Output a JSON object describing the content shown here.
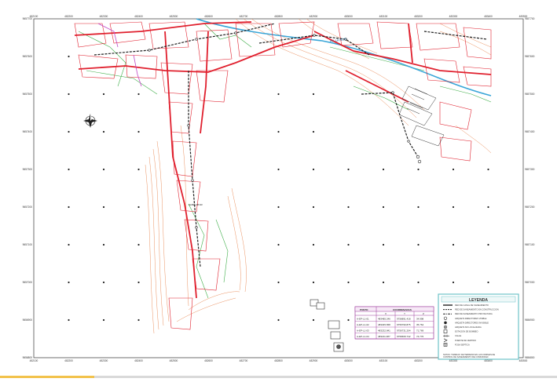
{
  "map": {
    "colors": {
      "frame": "#4d4d4d",
      "street": "#e0202e",
      "network": "#222222",
      "contour": "#e8854f",
      "parcel": "#3fae49",
      "river": "#3aa6d8",
      "magenta": "#c04ac7",
      "legend_border": "#6fc3c9",
      "legend_fill": "#eef8f8",
      "table_border": "#9b3a9b"
    },
    "x_ticks": [
      "482100",
      "482200",
      "482300",
      "482400",
      "482500",
      "482600",
      "482700",
      "482800",
      "482900",
      "483000",
      "483100",
      "483200",
      "483300",
      "483400",
      "483500"
    ],
    "y_ticks": [
      "9657700",
      "9657600",
      "9657500",
      "9657400",
      "9657300",
      "9657200",
      "9657100",
      "9657000",
      "9656900",
      "9656800"
    ],
    "label_pointer": "ALBELAPUR",
    "label_road": "AV. LA NOB",
    "north_symbol": "north-arrow",
    "legend": {
      "title": "LEYENDA",
      "items": [
        {
          "label": "RED DE CANAL DE SANEAMIENTO",
          "symbol": "line-thick"
        },
        {
          "label": "RED DE SANEAMIENTO EN CONSTRUCCION",
          "symbol": "line-dash"
        },
        {
          "label": "RED DE SANEAMIENTO PROYECTADA",
          "symbol": "line-dashdot"
        },
        {
          "label": "ARQUETA DIRECTORES VISIBLE",
          "symbol": "circle-open"
        },
        {
          "label": "ARQUETA DIRECTORES INVISIBLE",
          "symbol": "circle-filled"
        },
        {
          "label": "ARQUETA NO LOCALIZADA",
          "symbol": "circle-cross"
        },
        {
          "label": "ESTACION DE BOMBEO",
          "symbol": "square-open"
        },
        {
          "label": "CALLE",
          "symbol": "tick-line"
        },
        {
          "label": "PUENTE DE VERTIDO",
          "symbol": "arrow-mark"
        },
        {
          "label": "FOSA SEPTICA",
          "symbol": "square-circle"
        }
      ],
      "notes": "NOTAS: TRABAJO DE TERRENO EN LAS NORMAS DE\nCONTROL DE SANEAMIENTO DE COMUNIDAD"
    },
    "coord_table": {
      "header_point": "PUNTO",
      "header_coords": "COORDENADAS",
      "subheaders": [
        "X",
        "Y",
        "Z"
      ],
      "rows": [
        {
          "id": "A-EP-L1-01",
          "x": "483485.246",
          "y": "9756891.418",
          "z": "34.998"
        },
        {
          "id": "A-EP-L1-02",
          "x": "483345.658",
          "y": "9756790.875",
          "z": "35.764"
        },
        {
          "id": "A-EP-L1-03",
          "x": "483232.841",
          "y": "9756731.204",
          "z": "71.769"
        },
        {
          "id": "A-EP-L1-04",
          "x": "483211.087",
          "y": "9756669.742",
          "z": "74.776"
        }
      ]
    }
  }
}
